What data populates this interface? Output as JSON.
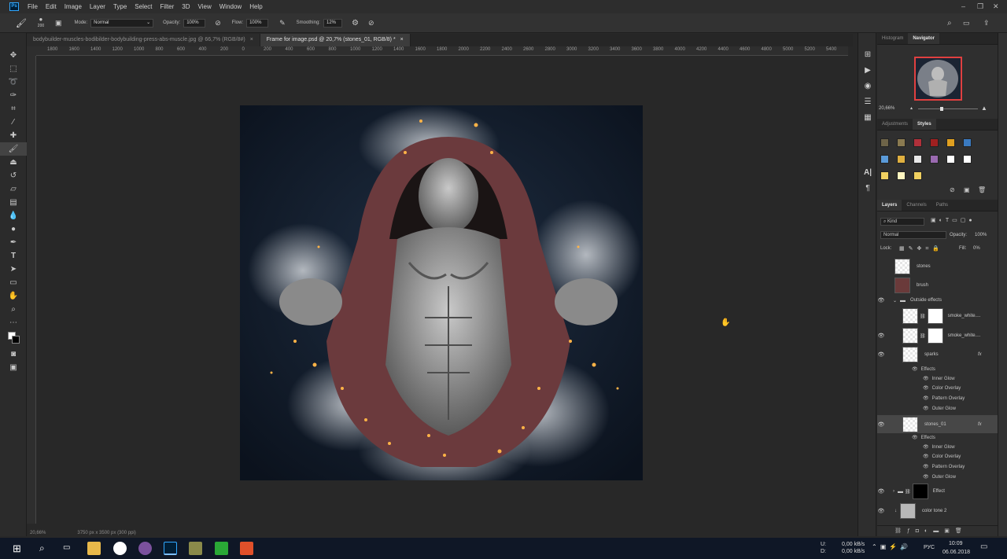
{
  "app": {
    "logo": "Ps"
  },
  "menu": [
    "File",
    "Edit",
    "Image",
    "Layer",
    "Type",
    "Select",
    "Filter",
    "3D",
    "View",
    "Window",
    "Help"
  ],
  "window_controls": {
    "minimize": "–",
    "maximize": "❐",
    "close": "✕"
  },
  "options": {
    "brush_size": "200",
    "mode_label": "Mode:",
    "mode_value": "Normal",
    "opacity_label": "Opacity:",
    "opacity_value": "100%",
    "flow_label": "Flow:",
    "flow_value": "100%",
    "smoothing_label": "Smoothing:",
    "smoothing_value": "12%"
  },
  "tabs": [
    {
      "label": "bodybuilder-muscles-bodibilder-bodybuilding-press-abs-muscle.jpg @ 66,7% (RGB/8#)",
      "close": "×"
    },
    {
      "label": "Frame for image.psd @ 20,7% (stones_01, RGB/8) *",
      "close": "×"
    }
  ],
  "ruler_labels": [
    "1800",
    "1600",
    "1400",
    "1200",
    "1000",
    "800",
    "600",
    "400",
    "200",
    "0",
    "200",
    "400",
    "600",
    "800",
    "1000",
    "1200",
    "1400",
    "1600",
    "1800",
    "2000",
    "2200",
    "2400",
    "2600",
    "2800",
    "3000",
    "3200",
    "3400",
    "3600",
    "3800",
    "4000",
    "4200",
    "4400",
    "4600",
    "4800",
    "5000",
    "5200",
    "5400"
  ],
  "status": {
    "zoom": "20,66%",
    "doc_size": "3750 px x 3500 px (300 ppi)"
  },
  "navigator": {
    "tabs": [
      "Histogram",
      "Navigator"
    ],
    "zoom": "20,66%"
  },
  "styles_panel": {
    "tabs": [
      "Adjustments",
      "Styles"
    ]
  },
  "layers_panel": {
    "tabs": [
      "Layers",
      "Channels",
      "Paths"
    ],
    "filter_label": "Kind",
    "blend_mode": "Normal",
    "opacity_label": "Opacity:",
    "opacity_value": "100%",
    "lock_label": "Lock:",
    "fill_label": "Fill:",
    "fill_value": "0%",
    "layers": {
      "stones": "stones",
      "brush": "brush",
      "outside_effects": "Outside effects",
      "smoke1": "smoke_white....",
      "smoke2": "smoke_white....",
      "sparks": "sparks",
      "stones01": "stones_01",
      "effect": "Effect",
      "color_tone": "color tone 2"
    },
    "effects": {
      "effects_label": "Effects",
      "items": [
        "Inner Glow",
        "Color Overlay",
        "Pattern Overlay",
        "Outer Glow"
      ]
    },
    "fx_badge": "fx"
  },
  "taskbar": {
    "net_up_label": "U:",
    "net_down_label": "D:",
    "net_up": "0,00 kB/s",
    "net_down": "0,00 kB/s",
    "lang": "РУС",
    "time": "10:09",
    "date": "06.06.2018"
  },
  "colors": {
    "accent_red": "#e04040",
    "ps_blue": "#31a8ff",
    "canvas_bg": "#0f1a29"
  }
}
